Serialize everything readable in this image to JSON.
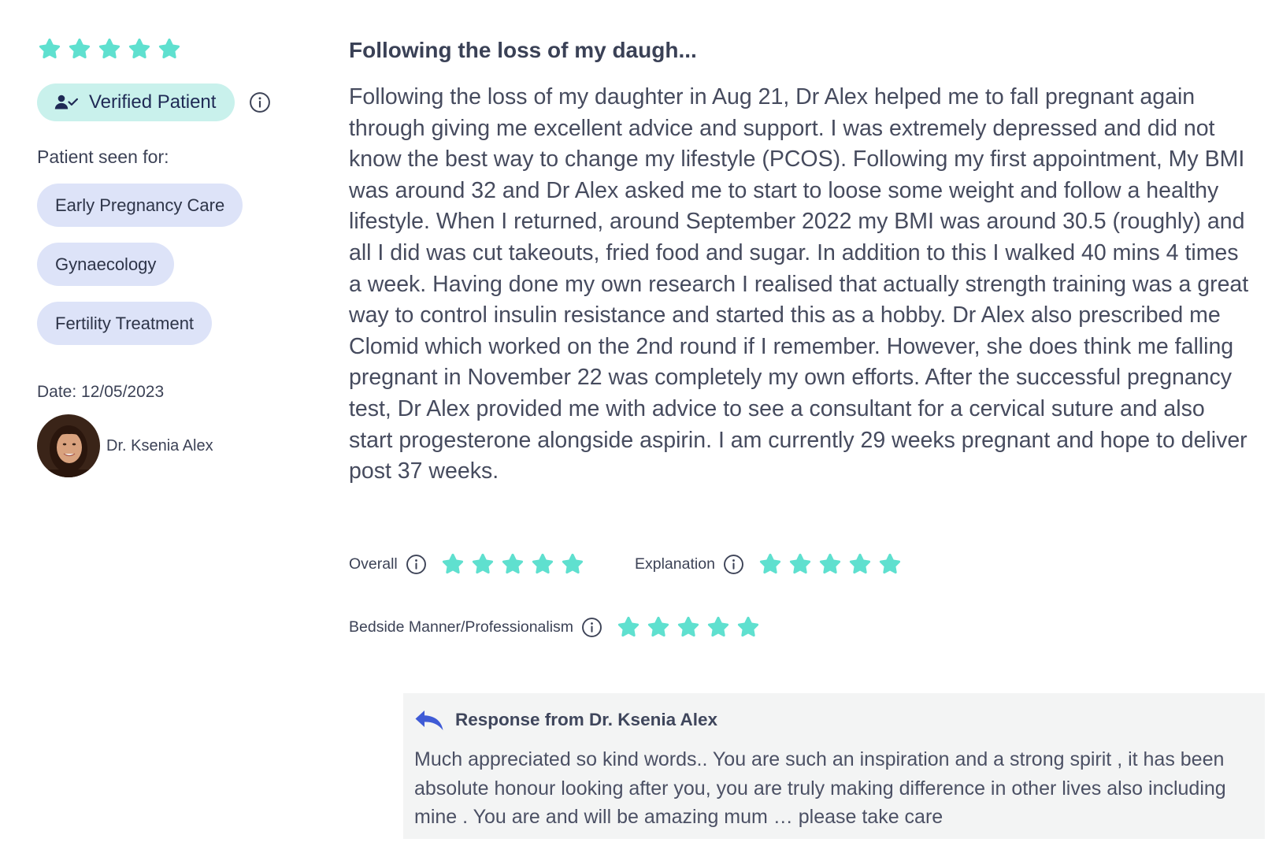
{
  "review": {
    "rating_stars": 5,
    "verified_label": "Verified Patient",
    "seen_for_label": "Patient seen for:",
    "treatments": [
      "Early Pregnancy Care",
      "Gynaecology",
      "Fertility Treatment"
    ],
    "date_text": "Date: 12/05/2023",
    "doctor_name": "Dr. Ksenia Alex",
    "title": "Following the loss of my daugh...",
    "body": "Following the loss of my daughter in Aug 21, Dr Alex helped me to fall pregnant again through giving me excellent advice and support. I was extremely depressed and did not know the best way to change my lifestyle (PCOS). Following my first appointment, My BMI was around 32 and Dr Alex asked me to start to loose some weight and follow a healthy lifestyle. When I returned, around September 2022 my BMI was around 30.5 (roughly) and all I did was cut takeouts, fried food and sugar. In addition to this I walked 40 mins 4 times a week. Having done my own research I realised that actually strength training was a great way to control insulin resistance and started this as a hobby. Dr Alex also prescribed me Clomid which worked on the 2nd round if I remember. However, she does think me falling pregnant in November 22 was completely my own efforts. After the successful pregnancy test, Dr Alex provided me with advice to see a consultant for a cervical suture and also start progesterone alongside aspirin. I am currently 29 weeks pregnant and hope to deliver post 37 weeks.",
    "ratings": {
      "overall": {
        "label": "Overall",
        "stars": 5
      },
      "explanation": {
        "label": "Explanation",
        "stars": 5
      },
      "bedside": {
        "label": "Bedside Manner/Professionalism",
        "stars": 5
      }
    }
  },
  "response": {
    "title": "Response from Dr. Ksenia Alex",
    "text": "Much appreciated so kind words.. You are such an inspiration and a strong spirit , it has been absolute honour looking after you, you are truly making difference in other lives also including mine . You are and will be amazing mum … please take care"
  },
  "colors": {
    "star": "#5fe0cf",
    "verified_bg": "#c9f1ec",
    "tag_bg": "#dde3f8",
    "response_bg": "#f3f4f4",
    "reply_icon": "#3f5bd6"
  },
  "icons": {
    "star": "star-icon",
    "verified": "user-check-icon",
    "info": "info-icon",
    "reply": "reply-arrow-icon"
  }
}
